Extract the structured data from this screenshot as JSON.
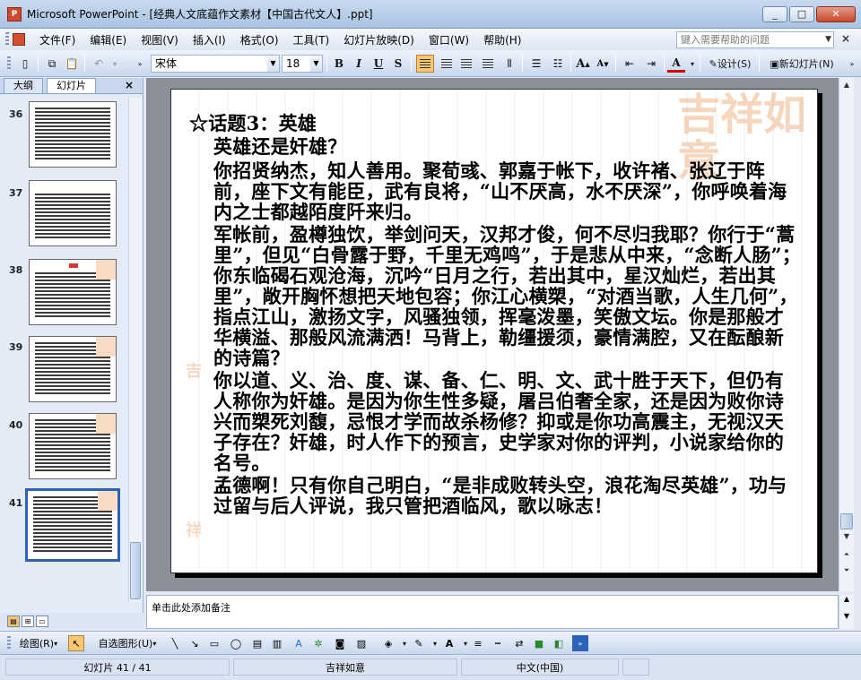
{
  "window": {
    "title": "Microsoft PowerPoint - [经典人文底蕴作文素材【中国古代文人】.ppt]",
    "app_icon": "powerpoint-icon",
    "buttons": [
      "_",
      "□",
      "✕"
    ]
  },
  "menu": {
    "items": [
      "文件(F)",
      "编辑(E)",
      "视图(V)",
      "插入(I)",
      "格式(O)",
      "工具(T)",
      "幻灯片放映(D)",
      "窗口(W)",
      "帮助(H)"
    ],
    "help_placeholder": "键入需要帮助的问题",
    "close": "×"
  },
  "toolbar": {
    "font_name": "宋体",
    "font_size": "18",
    "bold": "B",
    "italic": "I",
    "underline": "U",
    "shadow": "S",
    "design_label": "设计(S)",
    "new_slide_label": "新幻灯片(N)"
  },
  "leftpane": {
    "tabs": [
      "大纲",
      "幻灯片"
    ],
    "close": "×",
    "thumbnails": [
      {
        "number": "36"
      },
      {
        "number": "37"
      },
      {
        "number": "38"
      },
      {
        "number": "39"
      },
      {
        "number": "40"
      },
      {
        "number": "41",
        "selected": true
      }
    ]
  },
  "slide": {
    "decoration_text": "吉祥如意",
    "heading": "☆话题3：英雄",
    "subheading": "英雄还是奸雄？",
    "paragraphs": [
      "你招贤纳杰，知人善用。聚荀彧、郭嘉于帐下，收许褚、张辽于阵前，座下文有能臣，武有良将，“山不厌高，水不厌深”，你呼唤着海内之士都越陌度阡来归。",
      "军帐前，盈樽独饮，举剑问天，汉邦才俊，何不尽归我耶？你行于“蒿里”，但见“白骨露于野，千里无鸡鸣”，于是悲从中来，“念断人肠”；你东临碣石观沧海，沉吟“日月之行，若出其中，星汉灿烂，若出其里”，敞开胸怀想把天地包容；你江心横槊，“对酒当歌，人生几何”，指点江山，激扬文字，风骚独领，挥毫泼墨，笑傲文坛。你是那般才华横溢、那般风流满洒！马背上，勒缰援须，豪情满腔，又在酝酿新的诗篇？",
      "你以道、义、治、度、谋、备、仁、明、文、武十胜于天下，但仍有人称你为奸雄。是因为你生性多疑，屠吕伯奢全家，还是因为败你诗兴而槊死刘馥，忌恨才学而故杀杨修？抑或是你功高震主，无视汉天子存在？奸雄，时人作下的预言，史学家对你的评判，小说家给你的名号。",
      "孟德啊！只有你自己明白，“是非成败转头空，浪花淘尽英雄”，功与过留与后人评说，我只管把酒临风，歌以咏志！"
    ]
  },
  "notes": {
    "placeholder": "单击此处添加备注"
  },
  "drawbar": {
    "draw_label": "绘图(R)",
    "autoshapes_label": "自选图形(U)"
  },
  "status": {
    "slide_counter": "幻灯片 41 / 41",
    "design_name": "吉祥如意",
    "language": "中文(中国)"
  }
}
